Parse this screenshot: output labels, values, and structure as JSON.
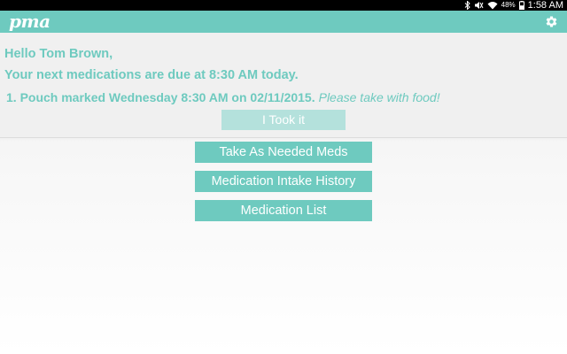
{
  "status_bar": {
    "battery": "48%",
    "time": "1:58 AM",
    "icons": [
      "bluetooth-icon",
      "mute-icon",
      "wifi-icon",
      "battery-icon"
    ]
  },
  "app_bar": {
    "logo": "pma",
    "settings_icon": "gear-icon",
    "background_color": "#6ecabf"
  },
  "reminder": {
    "greeting": "Hello Tom Brown,",
    "due_message": "Your next medications are due at 8:30 AM today.",
    "items": [
      {
        "text": "1. Pouch marked Wednesday 8:30 AM on 02/11/2015.",
        "note": "Please take with food!"
      }
    ],
    "took_it_label": "I Took it"
  },
  "actions": {
    "take_as_needed_label": "Take As Needed Meds",
    "intake_history_label": "Medication Intake History",
    "medication_list_label": "Medication List"
  },
  "colors": {
    "accent": "#6ecabf",
    "disabled_button": "#b4e1dc"
  }
}
